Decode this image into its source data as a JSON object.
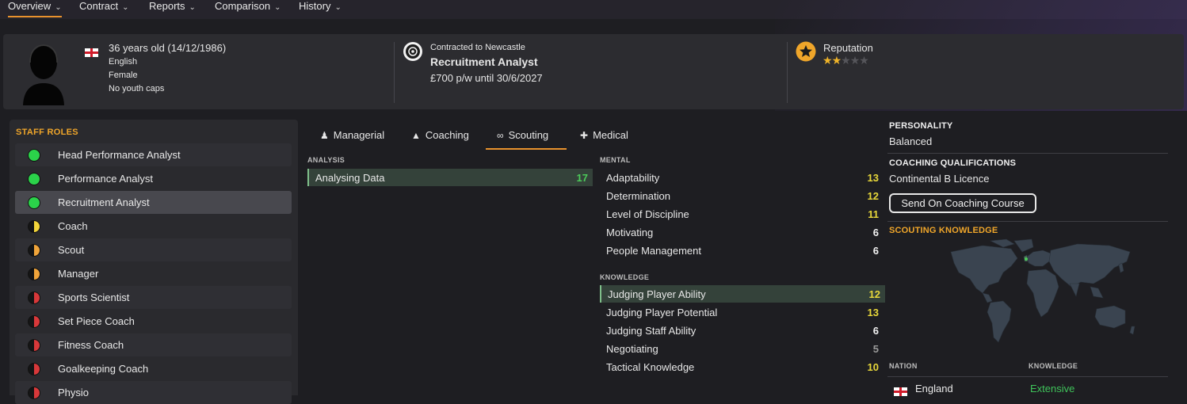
{
  "nav": {
    "tabs": [
      {
        "label": "Overview"
      },
      {
        "label": "Contract"
      },
      {
        "label": "Reports"
      },
      {
        "label": "Comparison"
      },
      {
        "label": "History"
      }
    ]
  },
  "profile": {
    "age_line": "36 years old (14/12/1986)",
    "nationality": "English",
    "gender": "Female",
    "caps": "No youth caps"
  },
  "contract": {
    "club_line": "Contracted to Newcastle",
    "role": "Recruitment Analyst",
    "wage_line": "£700 p/w until 30/6/2027"
  },
  "reputation": {
    "label": "Reputation",
    "stars": 2,
    "max_stars": 5
  },
  "staff_roles": {
    "title": "STAFF ROLES",
    "items": [
      {
        "label": "Head Performance Analyst",
        "status": "green"
      },
      {
        "label": "Performance Analyst",
        "status": "green"
      },
      {
        "label": "Recruitment Analyst",
        "status": "green"
      },
      {
        "label": "Coach",
        "status": "yellow-half"
      },
      {
        "label": "Scout",
        "status": "orange-half"
      },
      {
        "label": "Manager",
        "status": "orange-half"
      },
      {
        "label": "Sports Scientist",
        "status": "red-half"
      },
      {
        "label": "Set Piece Coach",
        "status": "red-half"
      },
      {
        "label": "Fitness Coach",
        "status": "red-half"
      },
      {
        "label": "Goalkeeping Coach",
        "status": "red-half"
      },
      {
        "label": "Physio",
        "status": "red-half"
      }
    ]
  },
  "attr_tabs": [
    {
      "label": "Managerial",
      "icon": "person-tie-icon"
    },
    {
      "label": "Coaching",
      "icon": "cones-icon"
    },
    {
      "label": "Scouting",
      "icon": "binoculars-icon"
    },
    {
      "label": "Medical",
      "icon": "medical-kit-icon"
    }
  ],
  "analysis": {
    "title": "ANALYSIS",
    "items": [
      {
        "name": "Analysing Data",
        "value": "17"
      }
    ]
  },
  "mental": {
    "title": "MENTAL",
    "items": [
      {
        "name": "Adaptability",
        "value": "13"
      },
      {
        "name": "Determination",
        "value": "12"
      },
      {
        "name": "Level of Discipline",
        "value": "11"
      },
      {
        "name": "Motivating",
        "value": "6"
      },
      {
        "name": "People Management",
        "value": "6"
      }
    ]
  },
  "knowledge": {
    "title": "KNOWLEDGE",
    "items": [
      {
        "name": "Judging Player Ability",
        "value": "12"
      },
      {
        "name": "Judging Player Potential",
        "value": "13"
      },
      {
        "name": "Judging Staff Ability",
        "value": "6"
      },
      {
        "name": "Negotiating",
        "value": "5"
      },
      {
        "name": "Tactical Knowledge",
        "value": "10"
      }
    ]
  },
  "personality": {
    "title": "PERSONALITY",
    "value": "Balanced"
  },
  "coaching_qualifications": {
    "title": "COACHING QUALIFICATIONS",
    "value": "Continental B Licence",
    "button": "Send On Coaching Course"
  },
  "scouting_knowledge": {
    "title": "SCOUTING KNOWLEDGE",
    "col_nation": "NATION",
    "col_knowledge": "KNOWLEDGE",
    "rows": [
      {
        "nation": "England",
        "knowledge": "Extensive"
      }
    ]
  },
  "colors": {
    "accent": "#e8922d",
    "green_value": "#4ccc5a",
    "yellow_value": "#e8d83a",
    "white_value": "#f2f2f2",
    "grey_value": "#9a9a9a",
    "extensive": "#3fc35a"
  }
}
